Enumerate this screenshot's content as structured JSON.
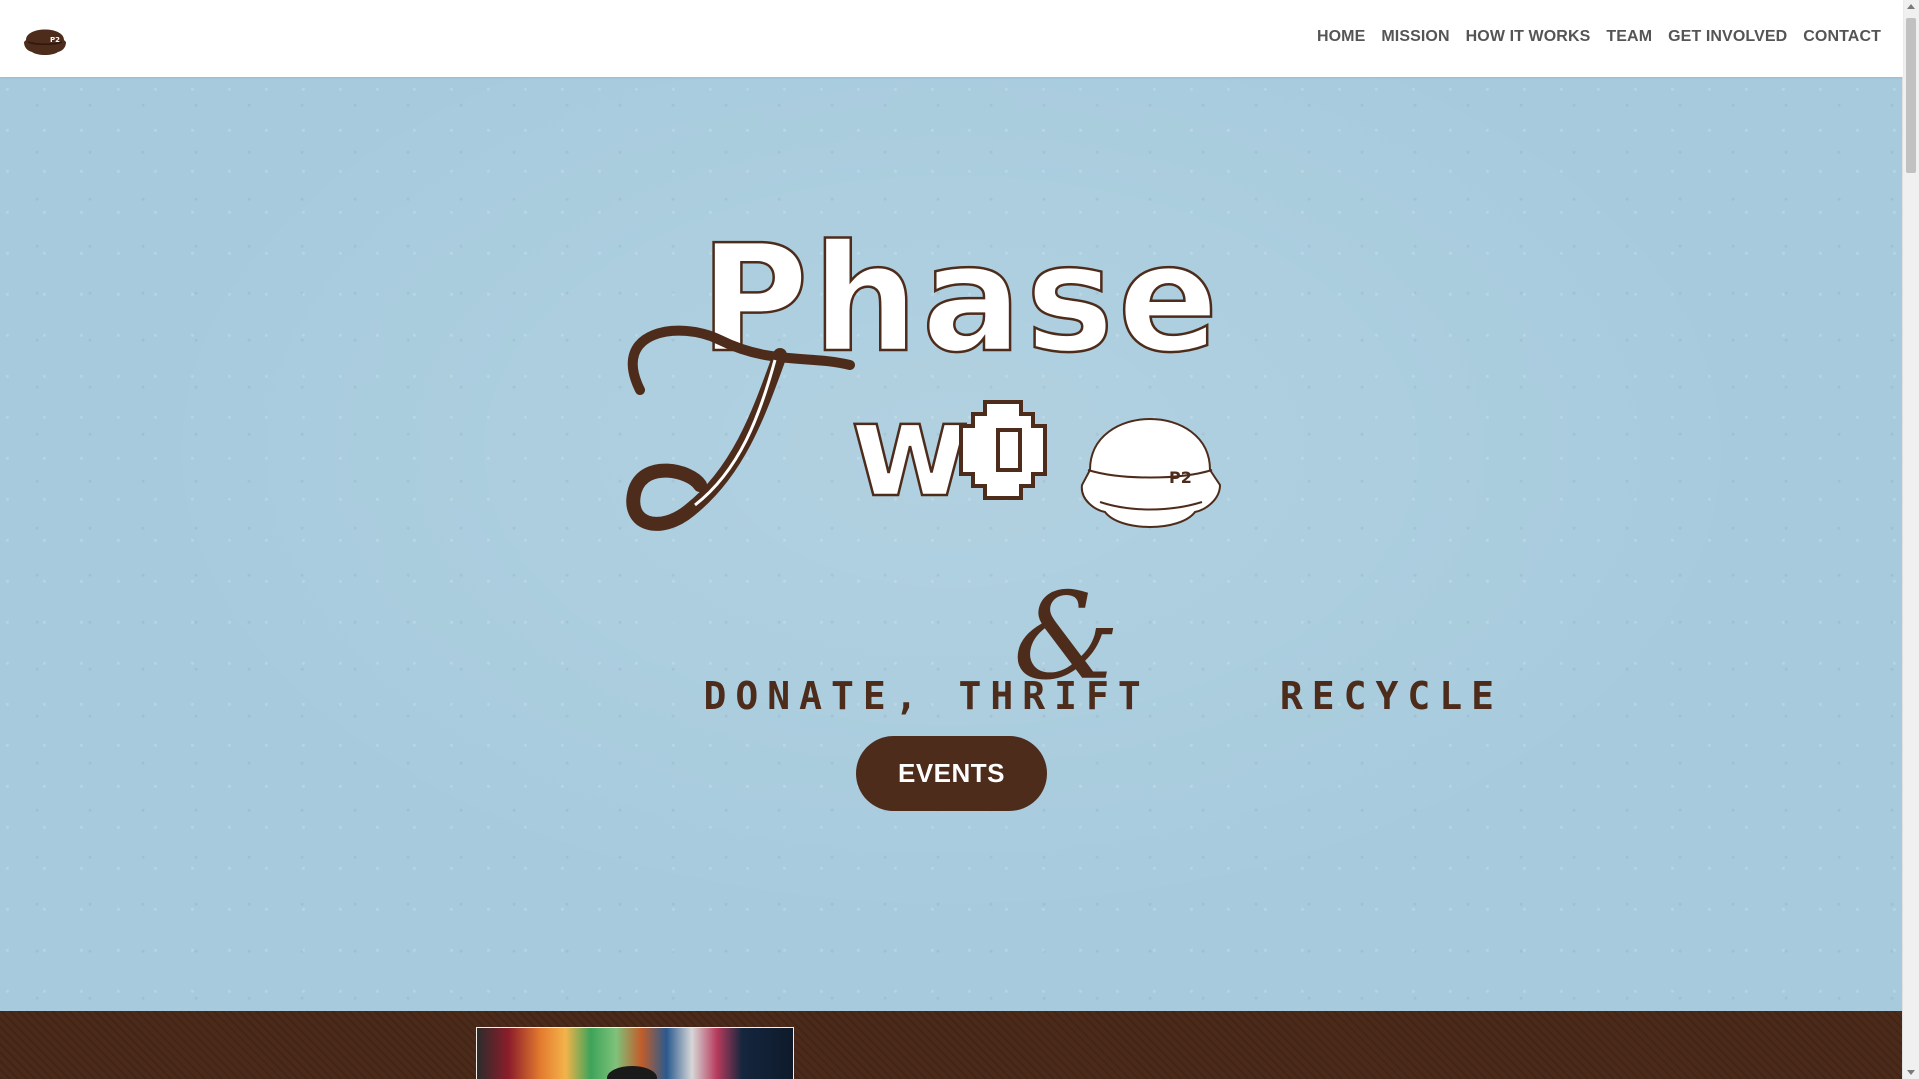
{
  "header": {
    "logo_icon": "p2-beanie-logo",
    "nav": [
      {
        "label": "HOME"
      },
      {
        "label": "MISSION"
      },
      {
        "label": "HOW IT WORKS"
      },
      {
        "label": "TEAM"
      },
      {
        "label": "GET INVOLVED"
      },
      {
        "label": "CONTACT"
      }
    ]
  },
  "hero": {
    "title_line1": "Phase",
    "title_line2": "Two",
    "hat_badge": "P2",
    "tagline_part1": "DONATE, THRIFT",
    "tagline_amp": "&",
    "tagline_part2": "RECYCLE",
    "cta_label": "EVENTS",
    "colors": {
      "background": "#a7cbdd",
      "brown": "#4e2c1b",
      "white": "#ffffff"
    }
  },
  "band": {
    "color": "#4b2a1a",
    "photo": "clothing-rack-photo"
  }
}
